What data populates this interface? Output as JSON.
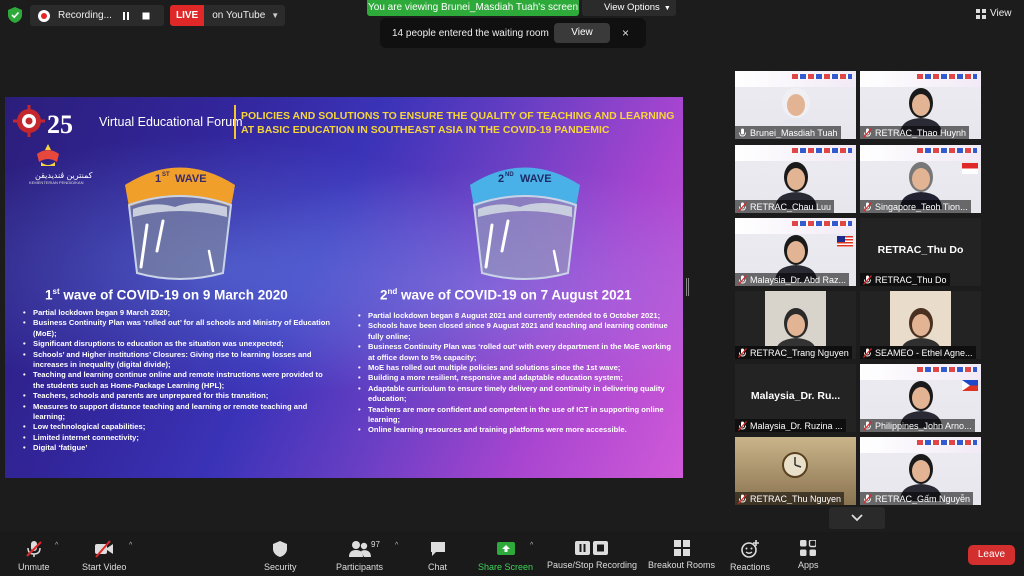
{
  "topbar": {
    "recording_label": "Recording...",
    "live_badge": "LIVE",
    "live_destination": "on YouTube",
    "viewing_banner": "You are viewing Brunei_Masdiah Tuah's screen",
    "view_options_label": "View Options",
    "waiting_message": "14 people entered the waiting room",
    "waiting_view_button": "View",
    "waiting_close": "×",
    "view_label": "View"
  },
  "slide": {
    "logo_number": "25",
    "brunei_text": "كمنترين ڤنديديقن",
    "brunei_subtext": "KEMENTERIAN PENDIDIKAN",
    "forum_title": "Virtual Educational Forum",
    "main_title_line1": "POLICIES AND SOLUTIONS TO ENSURE THE QUALITY OF TEACHING AND LEARNING",
    "main_title_line2": "AT BASIC EDUCATION IN SOUTHEAST ASIA IN THE COVID-19 PANDEMIC",
    "wave1_badge_num": "1",
    "wave1_badge_sup": "ST",
    "wave_badge_word": "WAVE",
    "wave2_badge_num": "2",
    "wave2_badge_sup": "ND",
    "wave1_title_num": "1",
    "wave1_title_sup": "st",
    "wave1_title_rest": " wave of COVID-19 on 9 March 2020",
    "wave2_title_num": "2",
    "wave2_title_sup": "nd",
    "wave2_title_rest": " wave of COVID-19 on 7 August 2021",
    "wave1_bullets": [
      "Partial lockdown began 9 March 2020;",
      "Business Continuity Plan was ‘rolled out’ for all schools and Ministry of Education (MoE);",
      "Significant disruptions to education as the situation was unexpected;",
      "Schools’ and Higher institutions’ Closures: Giving rise to learning losses and increases in inequality (digital divide);",
      "Teaching and learning continue online and remote instructions were provided to the students such as Home-Package Learning (HPL);",
      "Teachers, schools and parents are unprepared for this transition;",
      "Measures to support distance teaching and learning or remote teaching and learning;",
      "Low technological capabilities;",
      "Limited internet connectivity;",
      "Digital ‘fatigue’"
    ],
    "wave2_bullets": [
      "Partial lockdown began 8 August 2021 and currently extended to 6 October 2021;",
      "Schools have been closed since 9 August 2021 and teaching and learning continue fully online;",
      "Business Continuity Plan was ‘rolled out’ with every department in the MoE working at office down to 5% capacity;",
      "MoE has rolled out multiple policies and solutions since the 1st wave;",
      "Building a more resilient, responsive and adaptable education system;",
      "Adaptable curriculum to ensure timely delivery and continuity in delivering quality education;",
      "Teachers are more confident and competent in the use of ICT in supporting online learning;",
      "Online learning resources and training platforms were more accessible."
    ]
  },
  "participants": [
    {
      "name": "Brunei_Masdiah Tuah",
      "big": ""
    },
    {
      "name": "RETRAC_Thao Huynh",
      "big": ""
    },
    {
      "name": "RETRAC_Chau Luu",
      "big": ""
    },
    {
      "name": "Singapore_Teoh Tion...",
      "big": ""
    },
    {
      "name": "Malaysia_Dr. Abd Raz...",
      "big": ""
    },
    {
      "name": "RETRAC_Thu Do",
      "big": "RETRAC_Thu Do"
    },
    {
      "name": "RETRAC_Trang Nguyen",
      "big": ""
    },
    {
      "name": "SEAMEO - Ethel Agne...",
      "big": ""
    },
    {
      "name": "Malaysia_Dr. Ruzina ...",
      "big": "Malaysia_Dr. Ru..."
    },
    {
      "name": "Philippines_John Arno...",
      "big": ""
    },
    {
      "name": "RETRAC_Thu Nguyen",
      "big": ""
    },
    {
      "name": "RETRAC_Gấm Nguyễn",
      "big": ""
    }
  ],
  "toolbar": {
    "unmute": "Unmute",
    "start_video": "Start Video",
    "security": "Security",
    "participants": "Participants",
    "participants_count": "97",
    "chat": "Chat",
    "share_screen": "Share Screen",
    "pause_recording": "Pause/Stop Recording",
    "breakout_rooms": "Breakout Rooms",
    "reactions": "Reactions",
    "apps": "Apps",
    "leave": "Leave"
  },
  "colors": {
    "accent_green": "#2eaa3a",
    "live_red": "#e02828",
    "leave_red": "#d32f2f",
    "active_speaker": "#a6d83a",
    "slide_title_yellow": "#f5d53c"
  }
}
